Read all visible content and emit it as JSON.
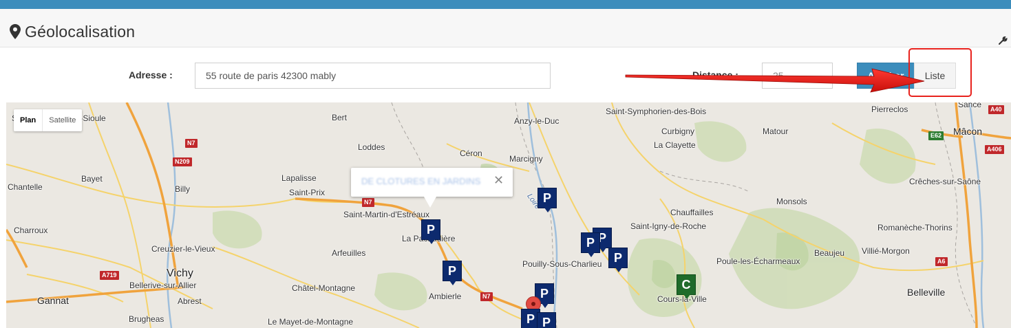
{
  "header": {
    "title": "Géolocalisation",
    "title_icon": "map-marker-icon",
    "settings_icon": "wrench-icon"
  },
  "form": {
    "address_label": "Adresse :",
    "address_value": "55 route de paris 42300 mably",
    "distance_label": "Distance :",
    "distance_value": "25",
    "show_button": "Afficher",
    "list_button": "Liste"
  },
  "annotation": {
    "highlight_color": "#e8211c"
  },
  "map": {
    "map_type_buttons": [
      "Plan",
      "Satellite"
    ],
    "active_map_type": "Plan",
    "info_window_text": "DE CLOTURES EN JARDINS",
    "places": [
      "Saint-Pourçain-sur-Sioule",
      "Bert",
      "Loddes",
      "Céron",
      "Anzy-le-Duc",
      "Marcigny",
      "Saint-Symphorien-des-Bois",
      "Curbigny",
      "La Clayette",
      "Matour",
      "Pierreclos",
      "Sancé",
      "Mâcon",
      "Lapalisse",
      "Saint-Prix",
      "Bayet",
      "Billy",
      "Chantelle",
      "Saint-Martin-d'Estréaux",
      "La Pacaudière",
      "Charroux",
      "Creuzier-le-Vieux",
      "Vichy",
      "Bellerive-sur-Allier",
      "Arfeuilles",
      "Châtel-Montagne",
      "Ambierle",
      "Abrest",
      "Gannat",
      "Brugheas",
      "Le Mayet-de-Montagne",
      "Pouilly-Sous-Charlieu",
      "Chauffailles",
      "Saint-Igny-de-Roche",
      "Monsols",
      "Crêches-sur-Saône",
      "Romanèche-Thorins",
      "Beaujeu",
      "Villié-Morgon",
      "Poule-les-Écharmeaux",
      "Cours-la-Ville",
      "Belleville",
      "Loire"
    ],
    "road_labels": [
      "N7",
      "N209",
      "N7",
      "A719",
      "N7",
      "A40",
      "E62",
      "A406",
      "A6"
    ],
    "marker_letter_p": "P",
    "marker_letter_c": "C"
  }
}
